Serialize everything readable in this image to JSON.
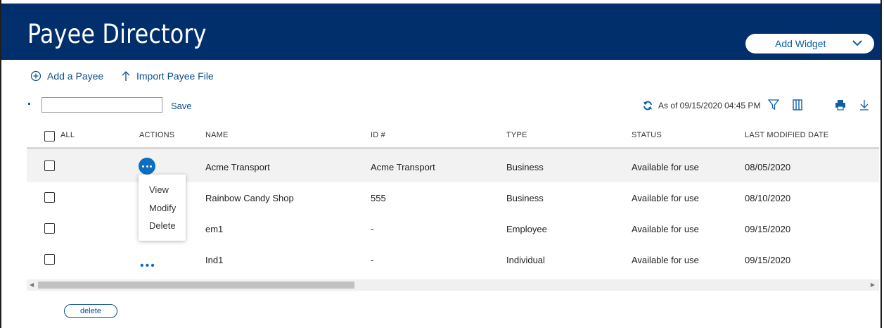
{
  "header": {
    "title": "Payee Directory",
    "add_widget_label": "Add Widget"
  },
  "toolbar": {
    "add_payee": "Add a Payee",
    "import_file": "Import Payee File",
    "save_label": "Save",
    "search_value": "",
    "as_of": "As of 09/15/2020 04:45 PM"
  },
  "table": {
    "columns": {
      "all": "ALL",
      "actions": "ACTIONS",
      "name": "NAME",
      "id": "ID #",
      "type": "TYPE",
      "status": "STATUS",
      "modified": "LAST MODIFIED DATE"
    },
    "rows": [
      {
        "name": "Acme Transport",
        "id": "Acme Transport",
        "type": "Business",
        "status": "Available for use",
        "modified": "08/05/2020"
      },
      {
        "name": "Rainbow Candy Shop",
        "id": "555",
        "type": "Business",
        "status": "Available for use",
        "modified": "08/10/2020"
      },
      {
        "name": "em1",
        "id": "-",
        "type": "Employee",
        "status": "Available for use",
        "modified": "09/15/2020"
      },
      {
        "name": "Ind1",
        "id": "-",
        "type": "Individual",
        "status": "Available for use",
        "modified": "09/15/2020"
      }
    ]
  },
  "actions_menu": {
    "view": "View",
    "modify": "Modify",
    "delete": "Delete"
  },
  "footer": {
    "delete_label": "delete"
  },
  "icons": {
    "add": "plus-circle-icon",
    "import": "upload-arrow-icon",
    "refresh": "refresh-icon",
    "filter": "filter-icon",
    "columns": "columns-icon",
    "print": "printer-icon",
    "download": "download-icon",
    "more": "more-dots-icon",
    "chevron": "chevron-down-icon"
  },
  "colors": {
    "header_bg": "#002f6c",
    "accent": "#0b6ec1",
    "link": "#0b4f8f"
  }
}
